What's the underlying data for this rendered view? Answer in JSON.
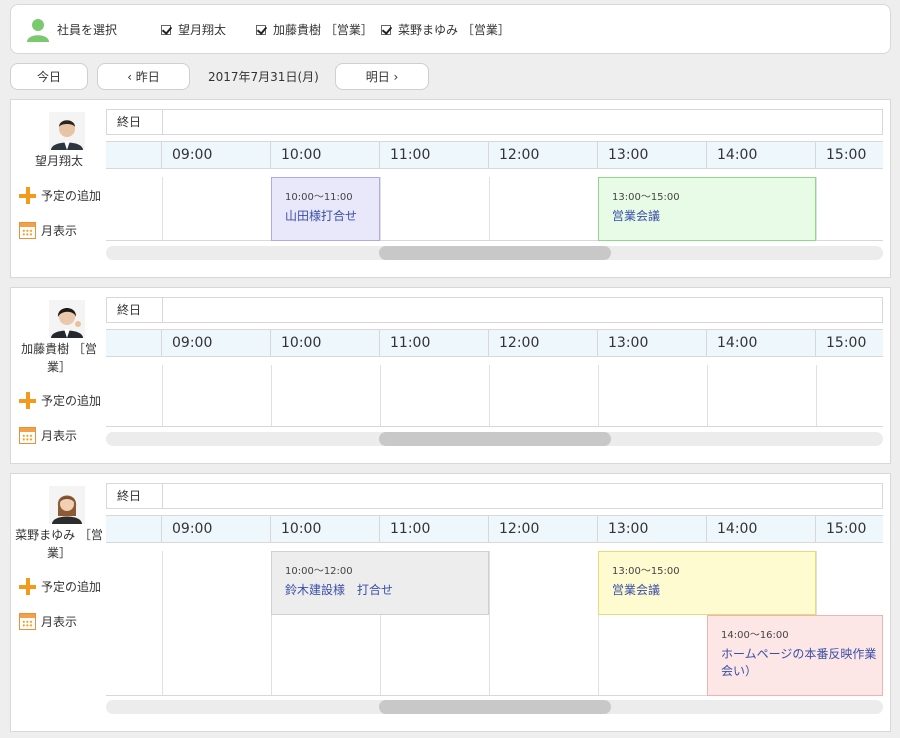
{
  "selector": {
    "label": "社員を選択",
    "employees": [
      {
        "name": "望月翔太",
        "checked": true
      },
      {
        "name": "加藤貴樹 ［営業］",
        "checked": true
      },
      {
        "name": "菜野まゆみ ［営業］",
        "checked": true
      }
    ]
  },
  "nav": {
    "today": "今日",
    "prev": "‹ 昨日",
    "date": "2017年7月31日(月)",
    "next": "明日 ›"
  },
  "schedule": {
    "allday_label": "終日",
    "hours": [
      "09:00",
      "10:00",
      "11:00",
      "12:00",
      "13:00",
      "14:00",
      "15:00"
    ],
    "add_label": "予定の追加",
    "month_label": "月表示"
  },
  "people": [
    {
      "name": "望月翔太",
      "events": [
        {
          "time": "10:00〜11:00",
          "title": "山田様打合せ",
          "start": "10:00",
          "end": "11:00",
          "row": 0,
          "bg": "#e9e8fb",
          "border": "#b0abe6"
        },
        {
          "time": "13:00〜15:00",
          "title": "営業会議",
          "start": "13:00",
          "end": "15:00",
          "row": 0,
          "bg": "#e8fbe6",
          "border": "#8fd88a"
        }
      ]
    },
    {
      "name": "加藤貴樹 ［営業］",
      "events": []
    },
    {
      "name": "菜野まゆみ ［営業］",
      "events": [
        {
          "time": "10:00〜12:00",
          "title": "鈴木建設様　打合せ",
          "start": "10:00",
          "end": "12:00",
          "row": 0,
          "bg": "#ededed",
          "border": "#d0d0d0"
        },
        {
          "time": "13:00〜15:00",
          "title": "営業会議",
          "start": "13:00",
          "end": "15:00",
          "row": 0,
          "bg": "#fdfbcf",
          "border": "#e4dd7a"
        },
        {
          "time": "14:00〜16:00",
          "title": "ホームページの本番反映作業会い）",
          "start": "14:00",
          "end": "16:00",
          "row": 1,
          "bg": "#fde6e6",
          "border": "#f2b2b2"
        }
      ]
    }
  ]
}
